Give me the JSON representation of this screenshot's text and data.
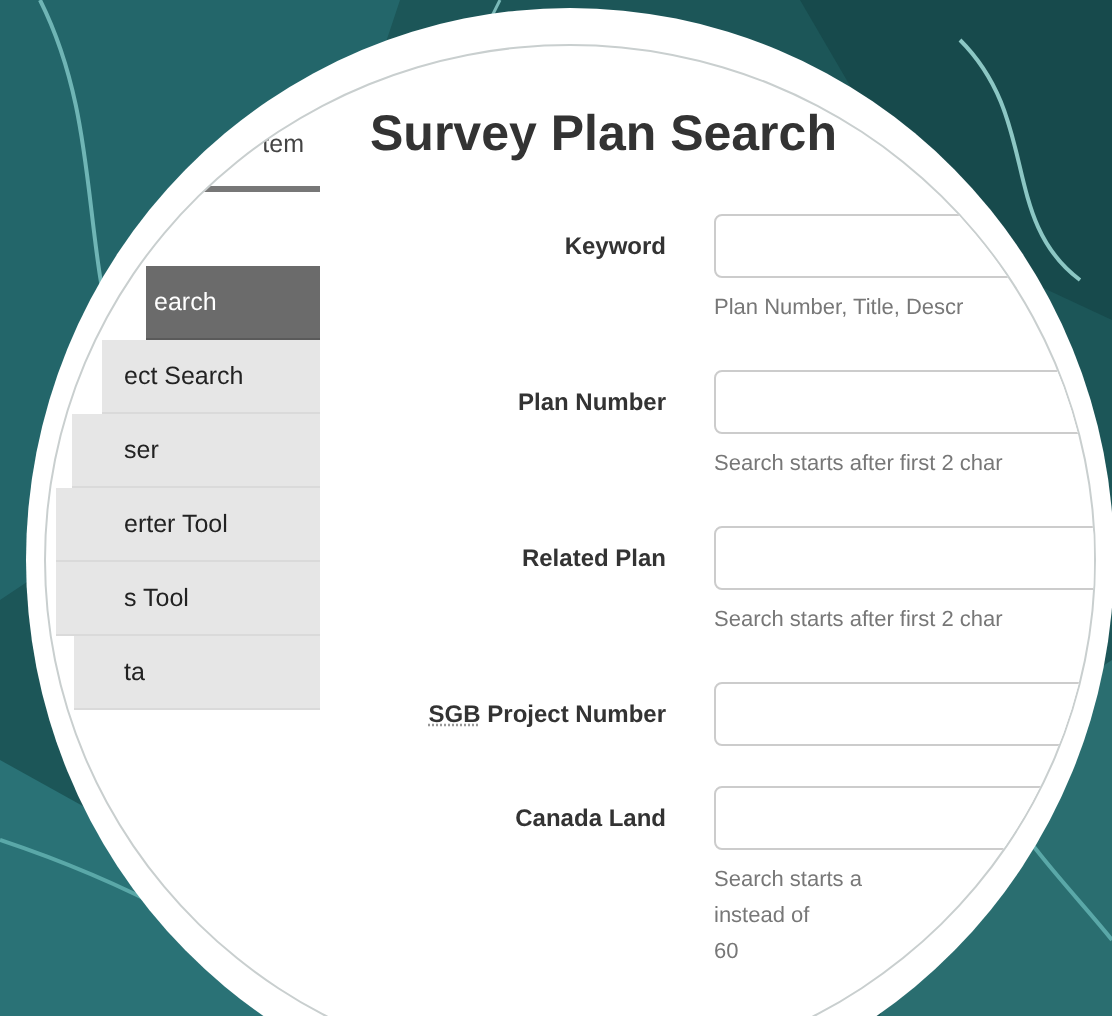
{
  "sidebar": {
    "header": "tem",
    "items": [
      {
        "label": "earch",
        "selected": true
      },
      {
        "label": "ect Search",
        "selected": false
      },
      {
        "label": "ser",
        "selected": false
      },
      {
        "label": "erter Tool",
        "selected": false
      },
      {
        "label": "s Tool",
        "selected": false
      },
      {
        "label": "ta",
        "selected": false
      }
    ]
  },
  "page_title": "Survey Plan Search",
  "fields": [
    {
      "label": "Keyword",
      "help": [
        "Plan Number, Title, Descr"
      ]
    },
    {
      "label": "Plan Number",
      "help": [
        "Search starts after first 2 char"
      ]
    },
    {
      "label": "Related Plan",
      "help": [
        "Search starts after first 2 char"
      ]
    },
    {
      "abbr": "SGB",
      "label": "Project Number"
    },
    {
      "label": "Canada Land",
      "help": [
        "Search starts a",
        "instead of",
        "60"
      ]
    }
  ]
}
